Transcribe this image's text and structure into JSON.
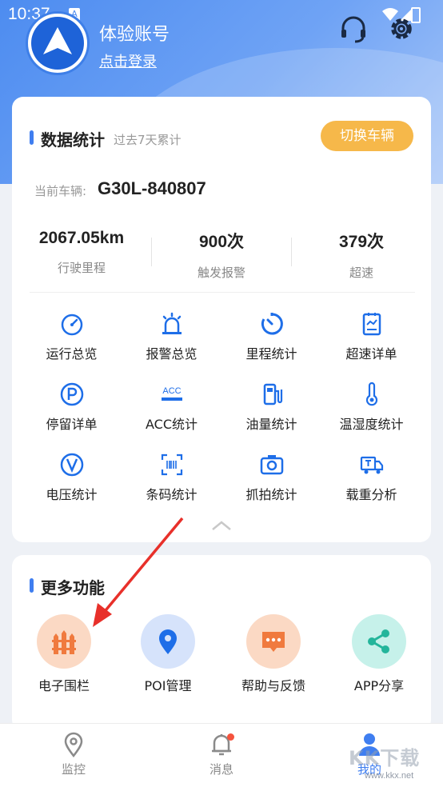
{
  "status_bar": {
    "time": "10:37",
    "notif_letter": "A"
  },
  "profile": {
    "name": "体验账号",
    "login_link": "点击登录"
  },
  "stats_card": {
    "title": "数据统计",
    "subtitle": "过去7天累计",
    "switch_label": "切换车辆",
    "vehicle_label": "当前车辆:",
    "vehicle_id": "G30L-840807",
    "stats": [
      {
        "value": "2067.05km",
        "label": "行驶里程"
      },
      {
        "value": "900次",
        "label": "触发报警"
      },
      {
        "value": "379次",
        "label": "超速"
      }
    ],
    "features": [
      {
        "label": "运行总览",
        "icon": "speedometer-icon"
      },
      {
        "label": "报警总览",
        "icon": "alarm-light-icon"
      },
      {
        "label": "里程统计",
        "icon": "timer-icon"
      },
      {
        "label": "超速详单",
        "icon": "report-chart-icon"
      },
      {
        "label": "停留详单",
        "icon": "parking-icon"
      },
      {
        "label": "ACC统计",
        "icon": "acc-icon",
        "icon_text": "ACC"
      },
      {
        "label": "油量统计",
        "icon": "fuel-pump-icon"
      },
      {
        "label": "温湿度统计",
        "icon": "thermometer-icon"
      },
      {
        "label": "电压统计",
        "icon": "voltage-icon"
      },
      {
        "label": "条码统计",
        "icon": "barcode-scan-icon"
      },
      {
        "label": "抓拍统计",
        "icon": "camera-icon"
      },
      {
        "label": "载重分析",
        "icon": "truck-icon"
      }
    ]
  },
  "more_card": {
    "title": "更多功能",
    "items": [
      {
        "label": "电子围栏",
        "icon": "fence-icon",
        "bg": "#fbd9c4",
        "fg": "#f07a3e"
      },
      {
        "label": "POI管理",
        "icon": "location-pin-icon",
        "bg": "#d6e3fb",
        "fg": "#1e6ee8"
      },
      {
        "label": "帮助与反馈",
        "icon": "chat-bubble-icon",
        "bg": "#fbd9c4",
        "fg": "#f07a3e"
      },
      {
        "label": "APP分享",
        "icon": "share-icon",
        "bg": "#c6f1ea",
        "fg": "#23b59b"
      }
    ]
  },
  "tabbar": {
    "tabs": [
      {
        "label": "监控",
        "icon": "map-pin-icon"
      },
      {
        "label": "消息",
        "icon": "bell-icon"
      },
      {
        "label": "我的",
        "icon": "user-icon"
      }
    ],
    "active": "我的"
  },
  "colors": {
    "accent": "#3f7ef0",
    "button": "#f6b84a",
    "arrow": "#e8302a"
  },
  "watermark": {
    "text": "KK下载",
    "url": "www.kkx.net"
  }
}
